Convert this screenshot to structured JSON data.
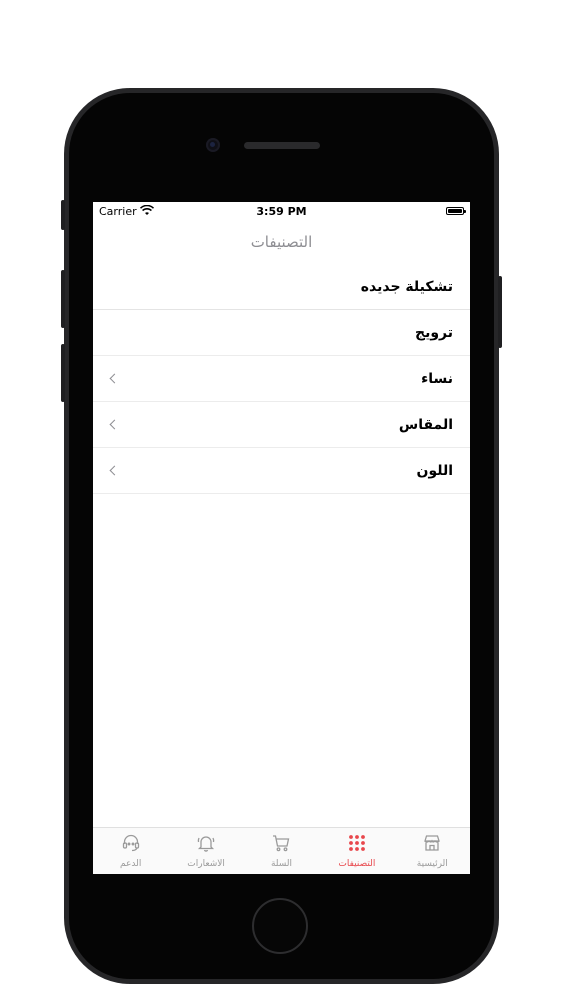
{
  "status_bar": {
    "carrier": "Carrier",
    "time": "3:59 PM"
  },
  "nav": {
    "title": "التصنيفات"
  },
  "categories": [
    {
      "label": "تشكيلة جديده",
      "has_chevron": false
    },
    {
      "label": "ترويج",
      "has_chevron": false
    },
    {
      "label": "نساء",
      "has_chevron": true
    },
    {
      "label": "المقاس",
      "has_chevron": true
    },
    {
      "label": "اللون",
      "has_chevron": true
    }
  ],
  "tabbar": {
    "active_color": "#e8474c",
    "inactive_color": "#9a9a9a",
    "items": [
      {
        "label": "الرئيسية",
        "icon": "store-icon",
        "active": false
      },
      {
        "label": "التصنيفات",
        "icon": "grid-dots-icon",
        "active": true
      },
      {
        "label": "السلة",
        "icon": "cart-icon",
        "active": false
      },
      {
        "label": "الاشعارات",
        "icon": "bell-icon",
        "active": false
      },
      {
        "label": "الدعم",
        "icon": "headset-icon",
        "active": false
      }
    ]
  }
}
